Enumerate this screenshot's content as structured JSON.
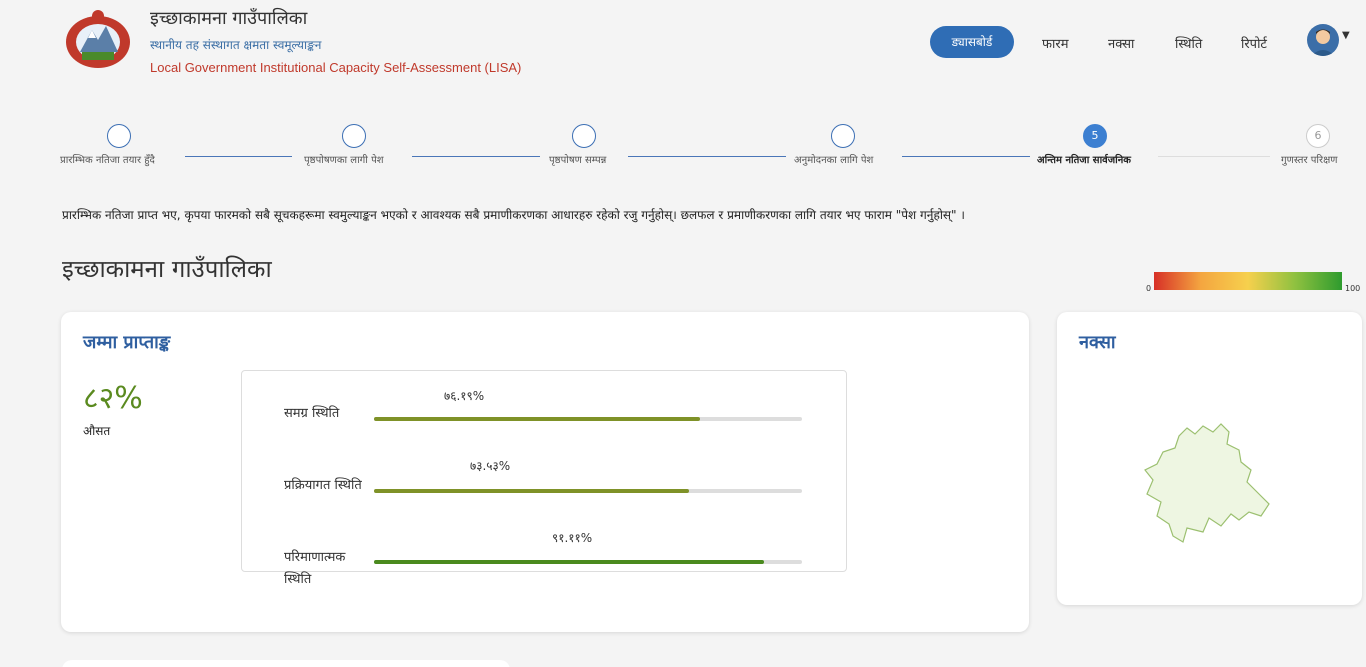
{
  "header": {
    "org_name": "इच्छाकामना गाउँपालिका",
    "org_subtitle": "स्थानीय तह संस्थागत क्षमता स्वमूल्याङ्कन",
    "org_english": "Local Government Institutional Capacity Self-Assessment (LISA)"
  },
  "nav": {
    "items": [
      "ड्यासबोर्ड",
      "फारम",
      "नक्सा",
      "स्थिति",
      "रिपोर्ट"
    ],
    "active_index": 0
  },
  "stepper": {
    "steps": [
      {
        "label": "प्रारम्भिक नतिजा तयार हुँदै",
        "number": ""
      },
      {
        "label": "पृष्ठपोषणका लागी पेश",
        "number": ""
      },
      {
        "label": "पृष्ठपोषण सम्पन्न",
        "number": ""
      },
      {
        "label": "अनुमोदनका लागि पेश",
        "number": ""
      },
      {
        "label": "अन्तिम नतिजा सार्वजनिक",
        "number": "5"
      },
      {
        "label": "गुणस्तर परिक्षण",
        "number": "6"
      }
    ]
  },
  "notice": "प्रारम्भिक नतिजा प्राप्त भए, कृपया फारमको सबै सूचकहरूमा स्वमुल्याङ्कन भएको र आवश्यक सबै प्रमाणीकरणका आधारहरु रहेको रजु गर्नुहोस्। छलफल र प्रमाणीकरणका लागि तयार भए फाराम \"पेश गर्नुहोस्\" ।",
  "page_title": "इच्छाकामना गाउँपालिका",
  "legend": {
    "min": "0",
    "max": "100"
  },
  "score_card": {
    "title": "जम्मा प्राप्ताङ्क",
    "total": "८२%",
    "total_label": "औसत",
    "bars": [
      {
        "label": "समग्र स्थिति",
        "value_text": "७६.१९%",
        "fraction": 0.7619,
        "color": "#7f9228"
      },
      {
        "label": "प्रक्रियागत स्थिति",
        "value_text": "७३.५३%",
        "fraction": 0.7353,
        "color": "#7f9228"
      },
      {
        "label": "परिमाणात्मक स्थिति",
        "value_text": "९१.११%",
        "fraction": 0.9111,
        "color": "#4a8a1e"
      }
    ]
  },
  "map_card": {
    "title": "नक्सा"
  }
}
